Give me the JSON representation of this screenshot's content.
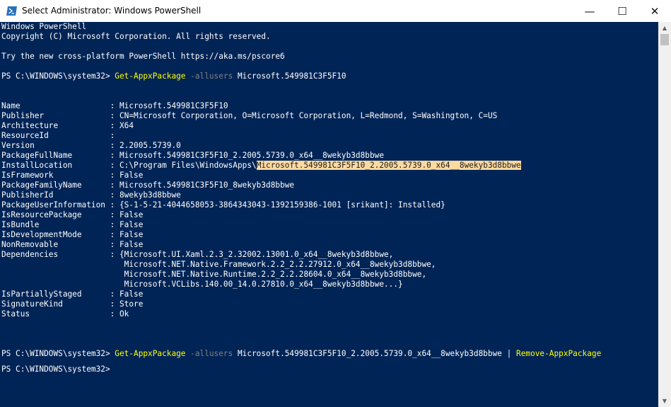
{
  "window": {
    "title": "Select Administrator: Windows PowerShell",
    "minimize_glyph": "—",
    "maximize_glyph": "☐",
    "close_glyph": "✕",
    "icon": "powershell-icon"
  },
  "console": {
    "banner_1": "Windows PowerShell",
    "banner_2": "Copyright (C) Microsoft Corporation. All rights reserved.",
    "banner_3": "Try the new cross-platform PowerShell https://aka.ms/pscore6",
    "cmd1": {
      "prompt": "PS C:\\WINDOWS\\system32> ",
      "command": "Get-AppxPackage",
      "param": " -allusers",
      "arg": " Microsoft.549981C3F5F10"
    },
    "props": [
      {
        "key": "Name                   ",
        "value": ": Microsoft.549981C3F5F10"
      },
      {
        "key": "Publisher              ",
        "value": ": CN=Microsoft Corporation, O=Microsoft Corporation, L=Redmond, S=Washington, C=US"
      },
      {
        "key": "Architecture           ",
        "value": ": X64"
      },
      {
        "key": "ResourceId             ",
        "value": ":"
      },
      {
        "key": "Version                ",
        "value": ": 2.2005.5739.0"
      },
      {
        "key": "PackageFullName        ",
        "value": ": Microsoft.549981C3F5F10_2.2005.5739.0_x64__8wekyb3d8bbwe"
      },
      {
        "key": "InstallLocation        ",
        "value": ": C:\\Program Files\\WindowsApps\\",
        "highlight": "Microsoft.549981C3F5F10_2.2005.5739.0_x64__8wekyb3d8bbwe"
      },
      {
        "key": "IsFramework            ",
        "value": ": False"
      },
      {
        "key": "PackageFamilyName      ",
        "value": ": Microsoft.549981C3F5F10_8wekyb3d8bbwe"
      },
      {
        "key": "PublisherId            ",
        "value": ": 8wekyb3d8bbwe"
      },
      {
        "key": "PackageUserInformation ",
        "value": ": {S-1-5-21-4044658053-3864343043-1392159386-1001 [srikant]: Installed}"
      },
      {
        "key": "IsResourcePackage      ",
        "value": ": False"
      },
      {
        "key": "IsBundle               ",
        "value": ": False"
      },
      {
        "key": "IsDevelopmentMode      ",
        "value": ": False"
      },
      {
        "key": "NonRemovable           ",
        "value": ": False"
      },
      {
        "key": "Dependencies           ",
        "value": ": {Microsoft.UI.Xaml.2.3_2.32002.13001.0_x64__8wekyb3d8bbwe,"
      },
      {
        "key": "                       ",
        "value": "   Microsoft.NET.Native.Framework.2.2_2.2.27912.0_x64__8wekyb3d8bbwe,"
      },
      {
        "key": "                       ",
        "value": "   Microsoft.NET.Native.Runtime.2.2_2.2.28604.0_x64__8wekyb3d8bbwe,"
      },
      {
        "key": "                       ",
        "value": "   Microsoft.VCLibs.140.00_14.0.27810.0_x64__8wekyb3d8bbwe...}"
      },
      {
        "key": "IsPartiallyStaged      ",
        "value": ": False"
      },
      {
        "key": "SignatureKind          ",
        "value": ": Store"
      },
      {
        "key": "Status                 ",
        "value": ": Ok"
      }
    ],
    "cmd2": {
      "prompt": "PS C:\\WINDOWS\\system32> ",
      "command": "Get-AppxPackage",
      "param": " -allusers",
      "arg": " Microsoft.549981C3F5F10_2.2005.5739.0_x64__8wekyb3d8bbwe | ",
      "command2": "Remove-AppxPackage"
    },
    "cmd3": {
      "prompt": "PS C:\\WINDOWS\\system32>"
    }
  },
  "colors": {
    "console_bg": "#012456",
    "command": "#ffff00",
    "parameter": "#808080",
    "selection": "#fcd99f"
  }
}
